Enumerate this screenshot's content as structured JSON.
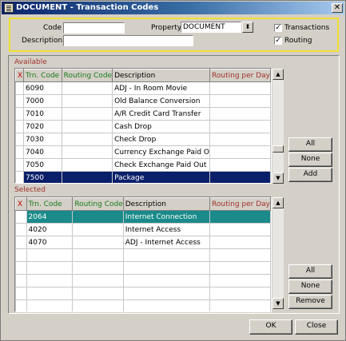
{
  "window": {
    "title": "DOCUMENT - Transaction Codes",
    "close_glyph": "✕"
  },
  "filter": {
    "code_label": "Code",
    "code_value": "",
    "property_label": "Property",
    "property_value": "DOCUMENT",
    "property_dropdown_glyph": "⬍",
    "description_label": "Description",
    "description_value": "",
    "transactions_label": "Transactions",
    "transactions_checked": true,
    "routing_label": "Routing",
    "routing_checked": true,
    "check_glyph": "✓"
  },
  "available": {
    "label": "Available",
    "columns": [
      "X",
      "Trn. Code",
      "Routing Code",
      "Description",
      "Routing per Day"
    ],
    "rows": [
      {
        "code": "6090",
        "routing": "",
        "description": "ADJ - In Room Movie",
        "per_day": ""
      },
      {
        "code": "7000",
        "routing": "",
        "description": "Old Balance Conversion",
        "per_day": ""
      },
      {
        "code": "7010",
        "routing": "",
        "description": "A/R Credit Card Transfer",
        "per_day": ""
      },
      {
        "code": "7020",
        "routing": "",
        "description": "Cash Drop",
        "per_day": ""
      },
      {
        "code": "7030",
        "routing": "",
        "description": "Check Drop",
        "per_day": ""
      },
      {
        "code": "7040",
        "routing": "",
        "description": "Currency Exchange Paid O",
        "per_day": ""
      },
      {
        "code": "7050",
        "routing": "",
        "description": "Check Exchange Paid Out",
        "per_day": ""
      },
      {
        "code": "7500",
        "routing": "",
        "description": "Package",
        "per_day": ""
      }
    ],
    "selected_row_index": 7,
    "buttons": {
      "all": "All",
      "none": "None",
      "add": "Add"
    }
  },
  "selected": {
    "label": "Selected",
    "columns": [
      "X",
      "Trn. Code",
      "Routing Code",
      "Description",
      "Routing per Day"
    ],
    "rows": [
      {
        "code": "2064",
        "routing": "",
        "description": "Internet Connection",
        "per_day": ""
      },
      {
        "code": "4020",
        "routing": "",
        "description": "Internet Access",
        "per_day": ""
      },
      {
        "code": "4070",
        "routing": "",
        "description": "ADJ - Internet Access",
        "per_day": ""
      },
      {
        "code": "",
        "routing": "",
        "description": "",
        "per_day": ""
      },
      {
        "code": "",
        "routing": "",
        "description": "",
        "per_day": ""
      },
      {
        "code": "",
        "routing": "",
        "description": "",
        "per_day": ""
      },
      {
        "code": "",
        "routing": "",
        "description": "",
        "per_day": ""
      },
      {
        "code": "",
        "routing": "",
        "description": "",
        "per_day": ""
      }
    ],
    "current_row_index": 0,
    "buttons": {
      "all": "All",
      "none": "None",
      "remove": "Remove"
    }
  },
  "scroll_glyphs": {
    "up": "▲",
    "down": "▼"
  },
  "footer": {
    "ok": "OK",
    "close": "Close"
  },
  "colors": {
    "accent_title": "#0a246a",
    "selected_row": "#0a1f6a",
    "current_row": "#1a8a8a",
    "filter_border": "#f0e030",
    "section_label": "#a0302c"
  }
}
